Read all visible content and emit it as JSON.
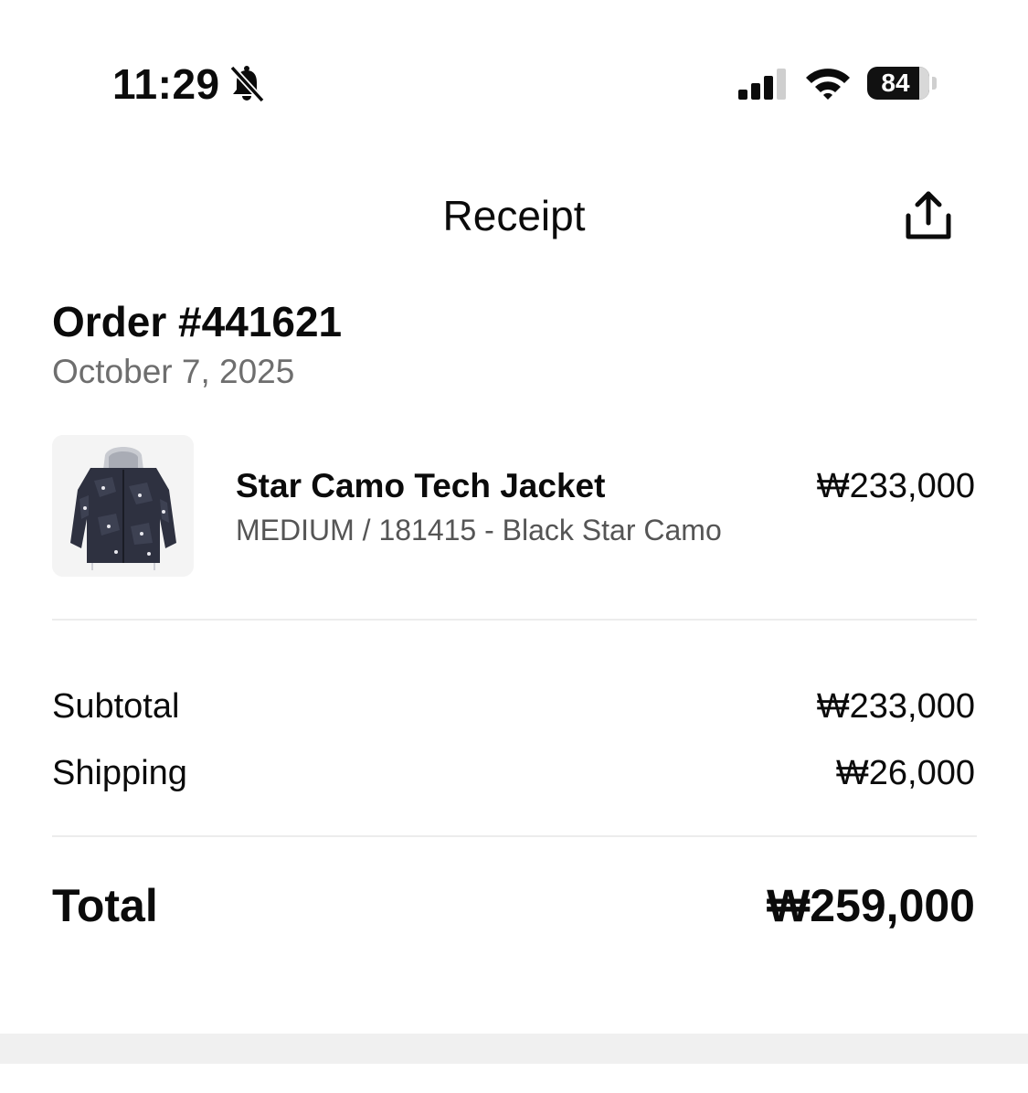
{
  "status_bar": {
    "time": "11:29",
    "silent_icon": "bell-slash-icon",
    "signal_icon": "cellular-signal-icon",
    "signal_bars": 3,
    "signal_bars_total": 4,
    "wifi_icon": "wifi-icon",
    "battery_percent": "84",
    "battery_level": 0.84
  },
  "nav": {
    "title": "Receipt",
    "share_icon": "share-icon"
  },
  "order": {
    "title": "Order #441621",
    "date": "October 7, 2025"
  },
  "items": [
    {
      "name": "Star Camo Tech Jacket",
      "variant": "MEDIUM / 181415 - Black Star Camo",
      "price": "₩233,000",
      "image": "jacket-product-image"
    }
  ],
  "summary": {
    "subtotal_label": "Subtotal",
    "subtotal_value": "₩233,000",
    "shipping_label": "Shipping",
    "shipping_value": "₩26,000",
    "total_label": "Total",
    "total_value": "₩259,000"
  },
  "colors": {
    "text": "#0b0b0b",
    "secondary_text": "#6e6e6e",
    "divider": "#ececec",
    "jacket": "#2e3140"
  }
}
